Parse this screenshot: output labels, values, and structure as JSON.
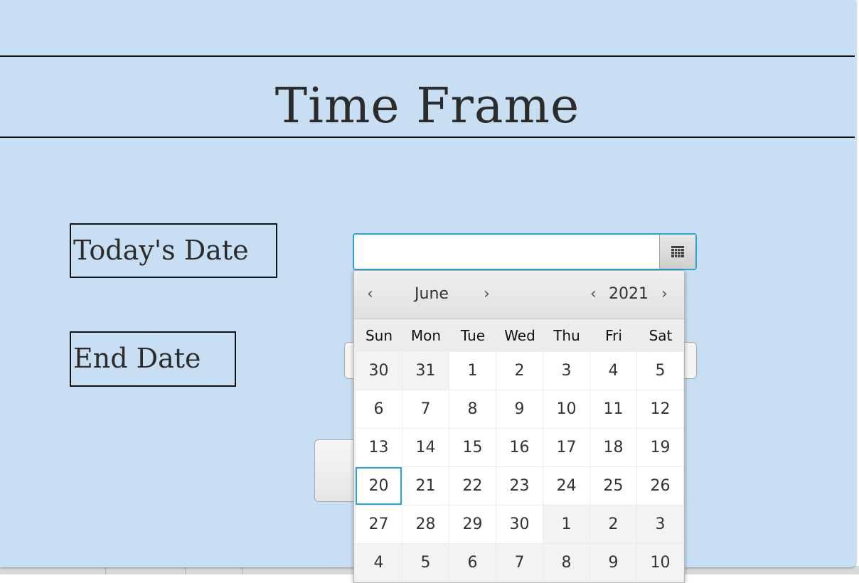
{
  "window": {
    "title": "Time Frame"
  },
  "labels": {
    "today": "Today's Date",
    "end": "End Date"
  },
  "date_picker": {
    "value": "",
    "month": "June",
    "year": "2021",
    "prev_month_glyph": "‹",
    "next_month_glyph": "›",
    "prev_year_glyph": "‹",
    "next_year_glyph": "›",
    "calendar_icon": "calendar-icon",
    "weekdays": [
      "Sun",
      "Mon",
      "Tue",
      "Wed",
      "Thu",
      "Fri",
      "Sat"
    ],
    "weeks": [
      [
        "30",
        "31",
        "1",
        "2",
        "3",
        "4",
        "5"
      ],
      [
        "6",
        "7",
        "8",
        "9",
        "10",
        "11",
        "12"
      ],
      [
        "13",
        "14",
        "15",
        "16",
        "17",
        "18",
        "19"
      ],
      [
        "20",
        "21",
        "22",
        "23",
        "24",
        "25",
        "26"
      ],
      [
        "27",
        "28",
        "29",
        "30",
        "1",
        "2",
        "3"
      ],
      [
        "4",
        "5",
        "6",
        "7",
        "8",
        "9",
        "10"
      ]
    ],
    "today_day": "20",
    "accent_color": "#2ba3d6"
  },
  "colors": {
    "window_bg": "#c8def2",
    "rule": "#111111"
  }
}
